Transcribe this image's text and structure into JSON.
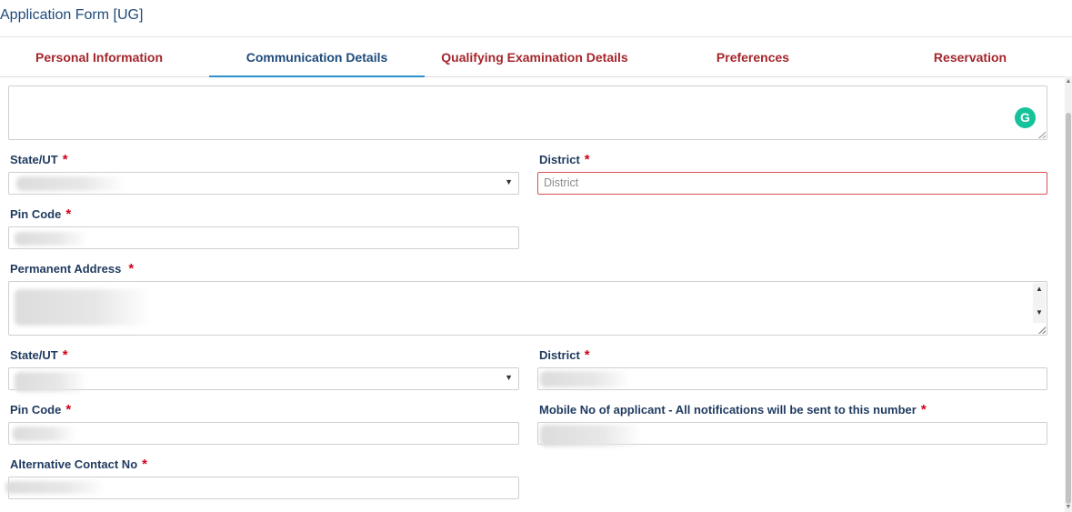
{
  "page": {
    "title": "Application Form [UG]"
  },
  "tabs": [
    {
      "label": "Personal Information",
      "active": false
    },
    {
      "label": "Communication Details",
      "active": true
    },
    {
      "label": "Qualifying Examination Details",
      "active": false
    },
    {
      "label": "Preferences",
      "active": false
    },
    {
      "label": "Reservation",
      "active": false
    }
  ],
  "correspondence": {
    "state_label": "State/UT",
    "district_label": "District",
    "district_placeholder": "District",
    "pincode_label": "Pin Code"
  },
  "permanent": {
    "address_label": "Permanent Address",
    "state_label": "State/UT",
    "district_label": "District",
    "pincode_label": "Pin Code",
    "mobile_label": "Mobile No of applicant - All notifications will be sent to this number",
    "alt_contact_label": "Alternative Contact No"
  },
  "required_marker": "*",
  "icons": {
    "grammarly": "G"
  }
}
